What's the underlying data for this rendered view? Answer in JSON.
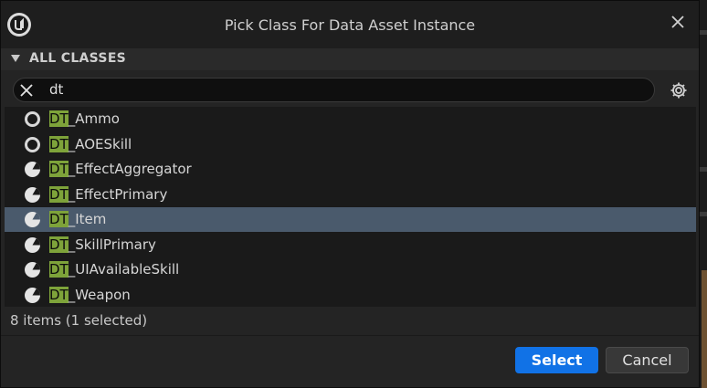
{
  "dialog": {
    "title": "Pick Class For Data Asset Instance"
  },
  "section": {
    "label": "ALL CLASSES"
  },
  "search": {
    "value": "dt"
  },
  "items": [
    {
      "highlight": "DT",
      "rest": "_Ammo",
      "icon": "ring-icon",
      "selected": false
    },
    {
      "highlight": "DT",
      "rest": "_AOESkill",
      "icon": "ring-icon",
      "selected": false
    },
    {
      "highlight": "DT",
      "rest": "_EffectAggregator",
      "icon": "pie-icon",
      "selected": false
    },
    {
      "highlight": "DT",
      "rest": "_EffectPrimary",
      "icon": "pie-icon",
      "selected": false
    },
    {
      "highlight": "DT",
      "rest": "_Item",
      "icon": "pie-icon",
      "selected": true
    },
    {
      "highlight": "DT",
      "rest": "_SkillPrimary",
      "icon": "pie-icon",
      "selected": false
    },
    {
      "highlight": "DT",
      "rest": "_UIAvailableSkill",
      "icon": "pie-icon",
      "selected": false
    },
    {
      "highlight": "DT",
      "rest": "_Weapon",
      "icon": "pie-icon",
      "selected": false
    }
  ],
  "status": "8 items (1 selected)",
  "buttons": {
    "select": "Select",
    "cancel": "Cancel"
  },
  "colors": {
    "accent": "#1172e6",
    "selection": "#4a5a6c",
    "match_highlight": "#7ea33a"
  }
}
